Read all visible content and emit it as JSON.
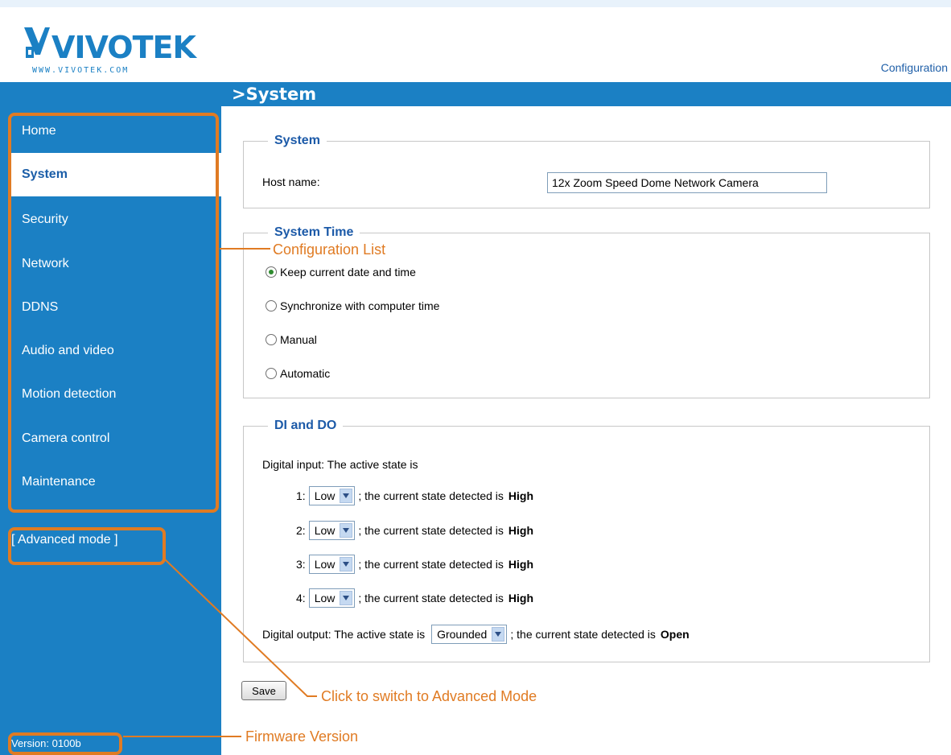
{
  "header": {
    "logo_text": "VIVOTEK",
    "logo_url_text": "WWW.VIVOTEK.COM",
    "config_link": "Configuration",
    "page_title": ">System"
  },
  "sidebar": {
    "items": [
      {
        "label": "Home"
      },
      {
        "label": "System"
      },
      {
        "label": "Security"
      },
      {
        "label": "Network"
      },
      {
        "label": "DDNS"
      },
      {
        "label": "Audio and video"
      },
      {
        "label": "Motion detection"
      },
      {
        "label": "Camera control"
      },
      {
        "label": "Maintenance"
      }
    ],
    "selected": "System",
    "advanced_link": "[ Advanced mode ]",
    "version": "Version: 0100b"
  },
  "system": {
    "legend": "System",
    "host_label": "Host name:",
    "host_value": "12x Zoom Speed Dome Network Camera"
  },
  "time": {
    "legend": "System Time",
    "options": [
      {
        "label": "Keep current date and time",
        "checked": true
      },
      {
        "label": "Synchronize with computer time",
        "checked": false
      },
      {
        "label": "Manual",
        "checked": false
      },
      {
        "label": "Automatic",
        "checked": false
      }
    ]
  },
  "dido": {
    "legend": "DI and DO",
    "input_label": "Digital input: The active state is",
    "inputs": [
      {
        "num": "1:",
        "value": "Low",
        "text": "; the current state detected is",
        "state": "High"
      },
      {
        "num": "2:",
        "value": "Low",
        "text": "; the current state detected is",
        "state": "High"
      },
      {
        "num": "3:",
        "value": "Low",
        "text": "; the current state detected is",
        "state": "High"
      },
      {
        "num": "4:",
        "value": "Low",
        "text": "; the current state detected is",
        "state": "High"
      }
    ],
    "output_label": "Digital output: The active state is",
    "output_value": "Grounded",
    "output_text": "; the current state detected is",
    "output_state": "Open"
  },
  "save_label": "Save",
  "annotations": {
    "config_list": "Configuration List",
    "advanced": "Click to switch to Advanced Mode",
    "firmware": "Firmware Version"
  },
  "colors": {
    "brand_blue": "#1b80c4",
    "annotation_orange": "#e07b23",
    "legend_blue": "#1c5aa8"
  }
}
